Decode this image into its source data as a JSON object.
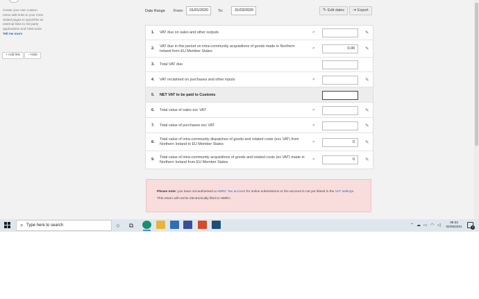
{
  "sidebar": {
    "blurb": "Create your own custom menu with links to your most visited pages in QuickFile as external links to 3rd party applications and CMS tools.",
    "tell_more": "Tell me more",
    "add_link": "Add link",
    "hide": "Hide"
  },
  "header": {
    "date_range_label": "Date Range",
    "from_label": "From:",
    "from_value": "01/01/2020",
    "to_label": "To:",
    "to_value": "31/03/2020",
    "edit_dates": "Edit dates",
    "export": "Export"
  },
  "vat_rows": [
    {
      "num": "1.",
      "desc": "VAT due on sales and other outputs",
      "value": "",
      "has_search": true,
      "has_edit": true,
      "shaded": false
    },
    {
      "num": "2.",
      "desc": "VAT due in this period on intra-community acquisitions of goods made in Northern Ireland from EU Member States",
      "value": "0.00",
      "has_search": true,
      "has_edit": true,
      "shaded": false
    },
    {
      "num": "3.",
      "desc": "Total VAT due",
      "value": "",
      "has_search": false,
      "has_edit": false,
      "shaded": false
    },
    {
      "num": "4.",
      "desc": "VAT reclaimed on purchases and other inputs",
      "value": "",
      "has_search": true,
      "has_edit": true,
      "shaded": false
    },
    {
      "num": "5.",
      "desc": "NET VAT to be paid to Customs",
      "value": "",
      "has_search": false,
      "has_edit": false,
      "shaded": true
    },
    {
      "num": "6.",
      "desc": "Total value of sales exc VAT",
      "value": "",
      "has_search": true,
      "has_edit": true,
      "shaded": false
    },
    {
      "num": "7.",
      "desc": "Total value of purchases exc VAT",
      "value": "",
      "has_search": true,
      "has_edit": true,
      "shaded": false
    },
    {
      "num": "8.",
      "desc": "Total value of intra-community dispatches of goods and related costs (exc VAT) from Northern Ireland to EU Member States",
      "value": "0",
      "has_search": true,
      "has_edit": true,
      "shaded": false
    },
    {
      "num": "9.",
      "desc": "Total value of intra-community acquisitions of goods and related costs (ex VAT) made in Northern Ireland from EU Member States",
      "value": "0",
      "has_search": true,
      "has_edit": true,
      "shaded": false
    }
  ],
  "notice": {
    "bold": "Please note:",
    "text1": " you have not authorised a ",
    "link1": "HMRC Tax account",
    "text2": " for online submissions or the account is not yet linked in the ",
    "link2": "VAT settings",
    "text3": ".",
    "line2": "This return will not be electronically filed to HMRC."
  },
  "taskbar": {
    "search_placeholder": "Type here to search",
    "time": "09:33",
    "date": "02/06/2021",
    "notification_count": "2"
  }
}
